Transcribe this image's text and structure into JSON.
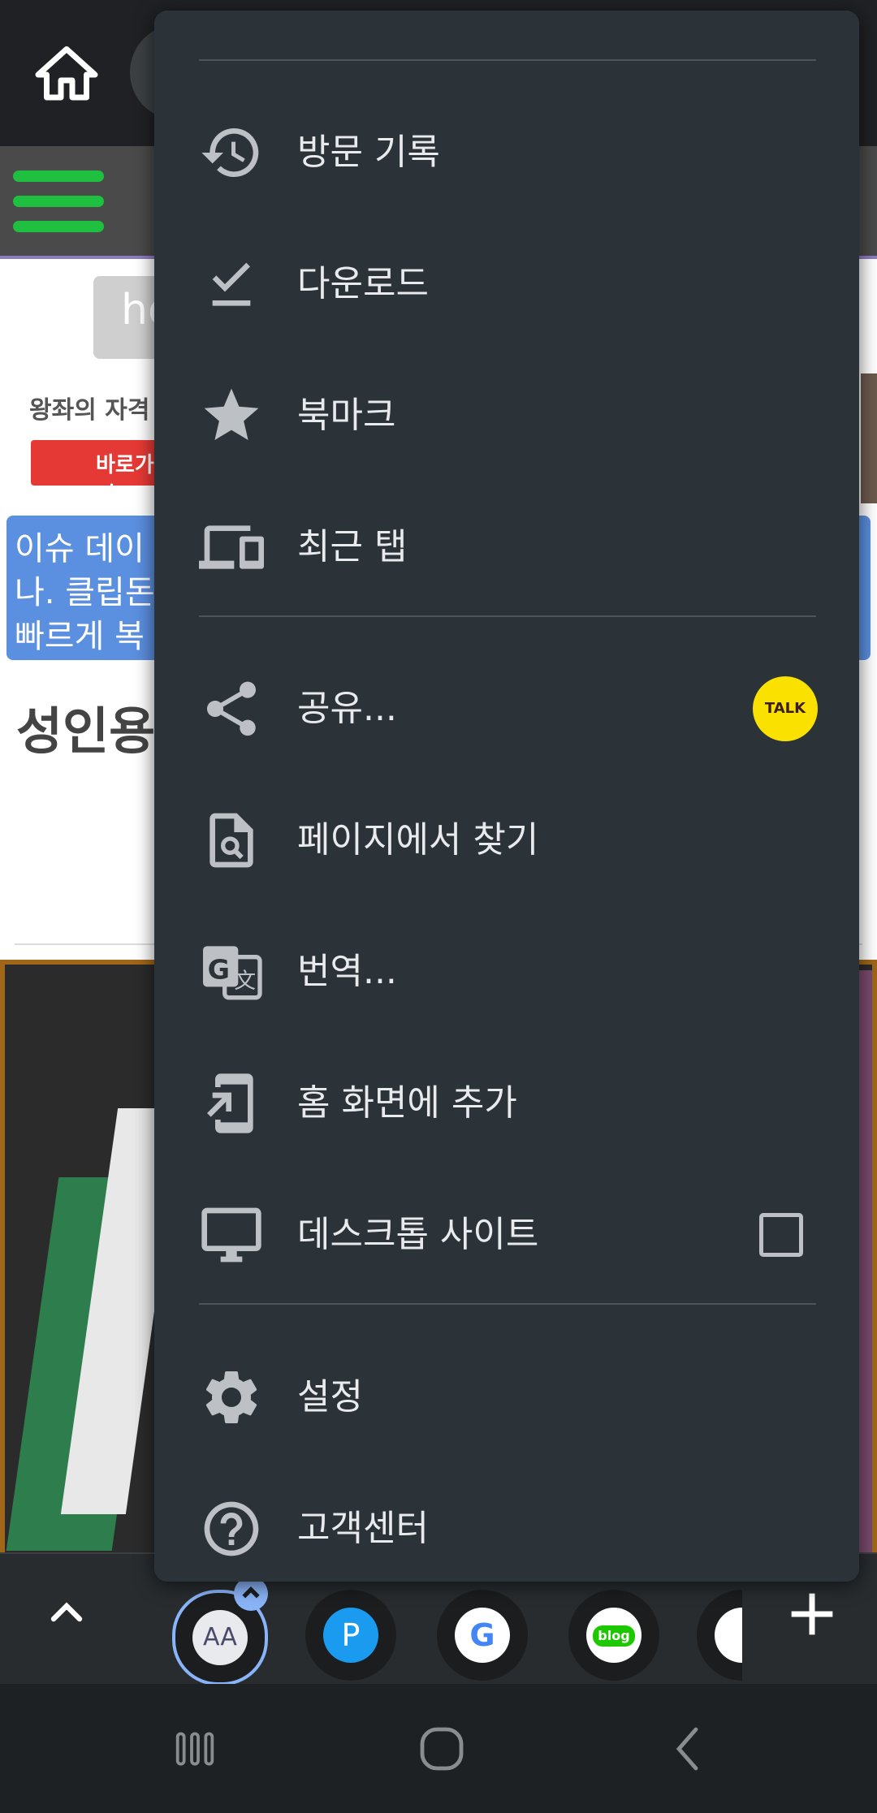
{
  "webpage": {
    "search_text": "ho",
    "ad_text": "왕좌의 자격",
    "ad_button": "바로가기",
    "notice_lines": [
      "이슈 데이",
      "나. 클립돈",
      "빠르게 복"
    ],
    "article_title": "성인용"
  },
  "menu": {
    "items": [
      {
        "label": "방문 기록",
        "icon": "history-icon"
      },
      {
        "label": "다운로드",
        "icon": "download-done-icon"
      },
      {
        "label": "북마크",
        "icon": "star-icon"
      },
      {
        "label": "최근 탭",
        "icon": "devices-icon"
      },
      {
        "label": "공유...",
        "icon": "share-icon",
        "badge": "TALK"
      },
      {
        "label": "페이지에서 찾기",
        "icon": "find-in-page-icon"
      },
      {
        "label": "번역...",
        "icon": "translate-icon"
      },
      {
        "label": "홈 화면에 추가",
        "icon": "add-to-home-screen-icon"
      },
      {
        "label": "데스크톱 사이트",
        "icon": "desktop-icon",
        "checked": false
      },
      {
        "label": "설정",
        "icon": "gear-icon"
      },
      {
        "label": "고객센터",
        "icon": "help-icon"
      }
    ]
  },
  "tabstrip": {
    "tabs": [
      "AA",
      "P",
      "G",
      "blog"
    ]
  },
  "colors": {
    "menu_bg": "#2b3339",
    "accent_green": "#1fbf3f",
    "kakao_yellow": "#fae100",
    "active_tab_ring": "#8ab4f8"
  }
}
